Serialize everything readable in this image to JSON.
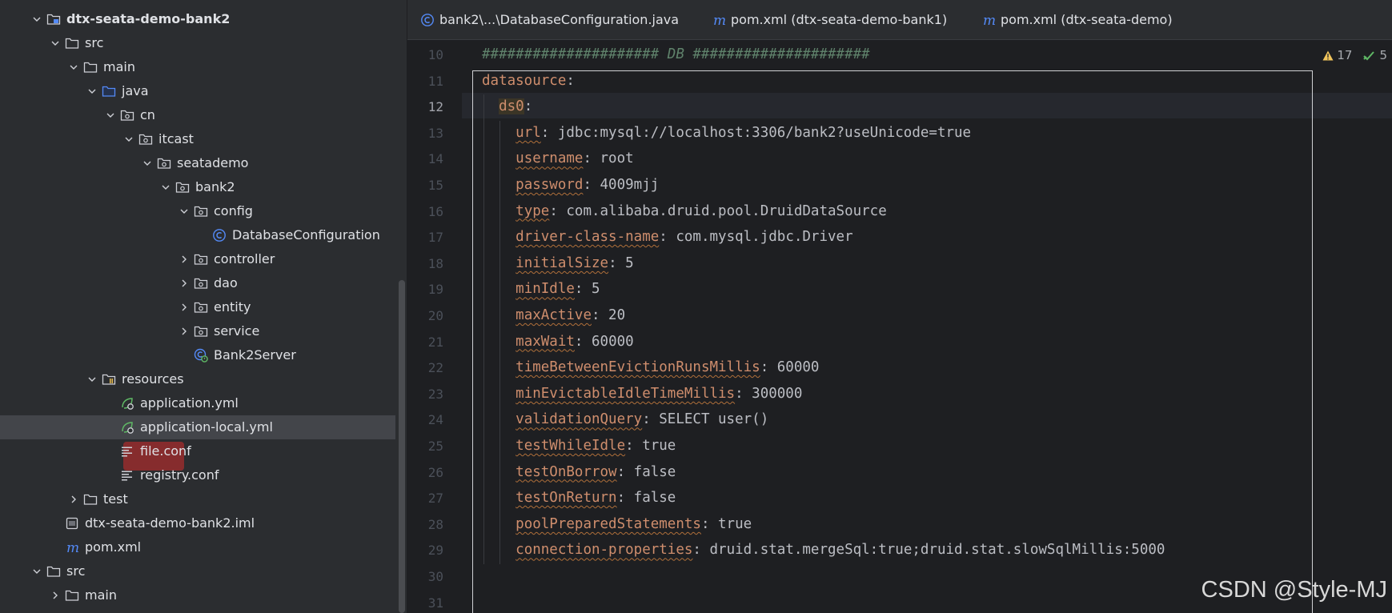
{
  "project_tree": {
    "items": [
      {
        "label": "dtx-seata-demo-bank2",
        "indent": 0,
        "expanded": true,
        "icon": "module-folder-icon",
        "bold": true
      },
      {
        "label": "src",
        "indent": 1,
        "expanded": true,
        "icon": "folder-icon"
      },
      {
        "label": "main",
        "indent": 2,
        "expanded": true,
        "icon": "folder-icon"
      },
      {
        "label": "java",
        "indent": 3,
        "expanded": true,
        "icon": "source-root-folder-icon"
      },
      {
        "label": "cn",
        "indent": 4,
        "expanded": true,
        "icon": "package-icon"
      },
      {
        "label": "itcast",
        "indent": 5,
        "expanded": true,
        "icon": "package-icon"
      },
      {
        "label": "seatademo",
        "indent": 6,
        "expanded": true,
        "icon": "package-icon"
      },
      {
        "label": "bank2",
        "indent": 7,
        "expanded": true,
        "icon": "package-icon"
      },
      {
        "label": "config",
        "indent": 8,
        "expanded": true,
        "icon": "package-icon"
      },
      {
        "label": "DatabaseConfiguration",
        "indent": 9,
        "icon": "java-class-icon"
      },
      {
        "label": "controller",
        "indent": 8,
        "expanded": false,
        "icon": "package-icon"
      },
      {
        "label": "dao",
        "indent": 8,
        "expanded": false,
        "icon": "package-icon"
      },
      {
        "label": "entity",
        "indent": 8,
        "expanded": false,
        "icon": "package-icon"
      },
      {
        "label": "service",
        "indent": 8,
        "expanded": false,
        "icon": "package-icon"
      },
      {
        "label": "Bank2Server",
        "indent": 8,
        "icon": "spring-boot-class-icon"
      },
      {
        "label": "resources",
        "indent": 3,
        "expanded": true,
        "icon": "resources-folder-icon"
      },
      {
        "label": "application.yml",
        "indent": 4,
        "icon": "spring-yaml-icon"
      },
      {
        "label": "application-local.yml",
        "indent": 4,
        "icon": "spring-yaml-icon",
        "selected": true
      },
      {
        "label": "file.conf",
        "indent": 4,
        "icon": "text-file-icon"
      },
      {
        "label": "registry.conf",
        "indent": 4,
        "icon": "text-file-icon"
      },
      {
        "label": "test",
        "indent": 2,
        "expanded": false,
        "icon": "folder-icon"
      },
      {
        "label": "dtx-seata-demo-bank2.iml",
        "indent": 1,
        "icon": "iml-file-icon"
      },
      {
        "label": "pom.xml",
        "indent": 1,
        "icon": "maven-icon"
      },
      {
        "label": "src",
        "indent": 0,
        "expanded": true,
        "icon": "folder-icon"
      },
      {
        "label": "main",
        "indent": 1,
        "expanded": false,
        "icon": "folder-icon"
      }
    ]
  },
  "tabs": [
    {
      "label": "bank2\\...\\DatabaseConfiguration.java",
      "icon": "java-class-icon"
    },
    {
      "label": "pom.xml (dtx-seata-demo-bank1)",
      "icon": "maven-icon"
    },
    {
      "label": "pom.xml (dtx-seata-demo)",
      "icon": "maven-icon"
    }
  ],
  "editor": {
    "inspections": {
      "warnings": "17",
      "ok": "5"
    },
    "lines": [
      {
        "n": "10",
        "parts": [
          {
            "t": "##################### DB #####################",
            "c": "cmt"
          }
        ]
      },
      {
        "n": "11",
        "parts": [
          {
            "t": "datasource",
            "c": "k0"
          },
          {
            "t": ":",
            "c": ""
          }
        ]
      },
      {
        "n": "12",
        "parts": [
          {
            "t": "  ",
            "c": ""
          },
          {
            "t": "ds0",
            "c": "ds0"
          },
          {
            "t": ":",
            "c": ""
          }
        ]
      },
      {
        "n": "13",
        "parts": [
          {
            "t": "    ",
            "c": ""
          },
          {
            "t": "url",
            "c": "k"
          },
          {
            "t": ": jdbc:mysql://localhost:3306/bank2?useUnicode=true",
            "c": ""
          }
        ]
      },
      {
        "n": "14",
        "parts": [
          {
            "t": "    ",
            "c": ""
          },
          {
            "t": "username",
            "c": "k"
          },
          {
            "t": ": root",
            "c": ""
          }
        ]
      },
      {
        "n": "15",
        "parts": [
          {
            "t": "    ",
            "c": ""
          },
          {
            "t": "password",
            "c": "k"
          },
          {
            "t": ": 4009mjj",
            "c": ""
          }
        ]
      },
      {
        "n": "16",
        "parts": [
          {
            "t": "    ",
            "c": ""
          },
          {
            "t": "type",
            "c": "k"
          },
          {
            "t": ": com.alibaba.druid.pool.DruidDataSource",
            "c": ""
          }
        ]
      },
      {
        "n": "17",
        "parts": [
          {
            "t": "    ",
            "c": ""
          },
          {
            "t": "driver-class-name",
            "c": "k"
          },
          {
            "t": ": com.mysql.jdbc.Driver",
            "c": ""
          }
        ]
      },
      {
        "n": "18",
        "parts": [
          {
            "t": "    ",
            "c": ""
          },
          {
            "t": "initialSize",
            "c": "k"
          },
          {
            "t": ": 5",
            "c": ""
          }
        ]
      },
      {
        "n": "19",
        "parts": [
          {
            "t": "    ",
            "c": ""
          },
          {
            "t": "minIdle",
            "c": "k"
          },
          {
            "t": ": 5",
            "c": ""
          }
        ]
      },
      {
        "n": "20",
        "parts": [
          {
            "t": "    ",
            "c": ""
          },
          {
            "t": "maxActive",
            "c": "k"
          },
          {
            "t": ": 20",
            "c": ""
          }
        ]
      },
      {
        "n": "21",
        "parts": [
          {
            "t": "    ",
            "c": ""
          },
          {
            "t": "maxWait",
            "c": "k"
          },
          {
            "t": ": 60000",
            "c": ""
          }
        ]
      },
      {
        "n": "22",
        "parts": [
          {
            "t": "    ",
            "c": ""
          },
          {
            "t": "timeBetweenEvictionRunsMillis",
            "c": "k"
          },
          {
            "t": ": 60000",
            "c": ""
          }
        ]
      },
      {
        "n": "23",
        "parts": [
          {
            "t": "    ",
            "c": ""
          },
          {
            "t": "minEvictableIdleTimeMillis",
            "c": "k"
          },
          {
            "t": ": 300000",
            "c": ""
          }
        ]
      },
      {
        "n": "24",
        "parts": [
          {
            "t": "    ",
            "c": ""
          },
          {
            "t": "validationQuery",
            "c": "k"
          },
          {
            "t": ": SELECT user()",
            "c": ""
          }
        ]
      },
      {
        "n": "25",
        "parts": [
          {
            "t": "    ",
            "c": ""
          },
          {
            "t": "testWhileIdle",
            "c": "k"
          },
          {
            "t": ": true",
            "c": ""
          }
        ]
      },
      {
        "n": "26",
        "parts": [
          {
            "t": "    ",
            "c": ""
          },
          {
            "t": "testOnBorrow",
            "c": "k"
          },
          {
            "t": ": false",
            "c": ""
          }
        ]
      },
      {
        "n": "27",
        "parts": [
          {
            "t": "    ",
            "c": ""
          },
          {
            "t": "testOnReturn",
            "c": "k"
          },
          {
            "t": ": false",
            "c": ""
          }
        ]
      },
      {
        "n": "28",
        "parts": [
          {
            "t": "    ",
            "c": ""
          },
          {
            "t": "poolPreparedStatements",
            "c": "k"
          },
          {
            "t": ": true",
            "c": ""
          }
        ]
      },
      {
        "n": "29",
        "parts": [
          {
            "t": "    ",
            "c": ""
          },
          {
            "t": "connection-properties",
            "c": "k"
          },
          {
            "t": ": druid.stat.mergeSql:true;druid.stat.slowSqlMillis:5000",
            "c": ""
          }
        ]
      },
      {
        "n": "30",
        "parts": []
      },
      {
        "n": "31",
        "parts": []
      }
    ],
    "current_line": "12"
  },
  "watermark": "CSDN @Style-MJ",
  "colors": {
    "background": "#1e1f22",
    "panel": "#2b2d30",
    "yaml_key": "#cf8e6d",
    "comment": "#5f826b",
    "text": "#bcbec4",
    "accent_blue": "#548af7"
  }
}
